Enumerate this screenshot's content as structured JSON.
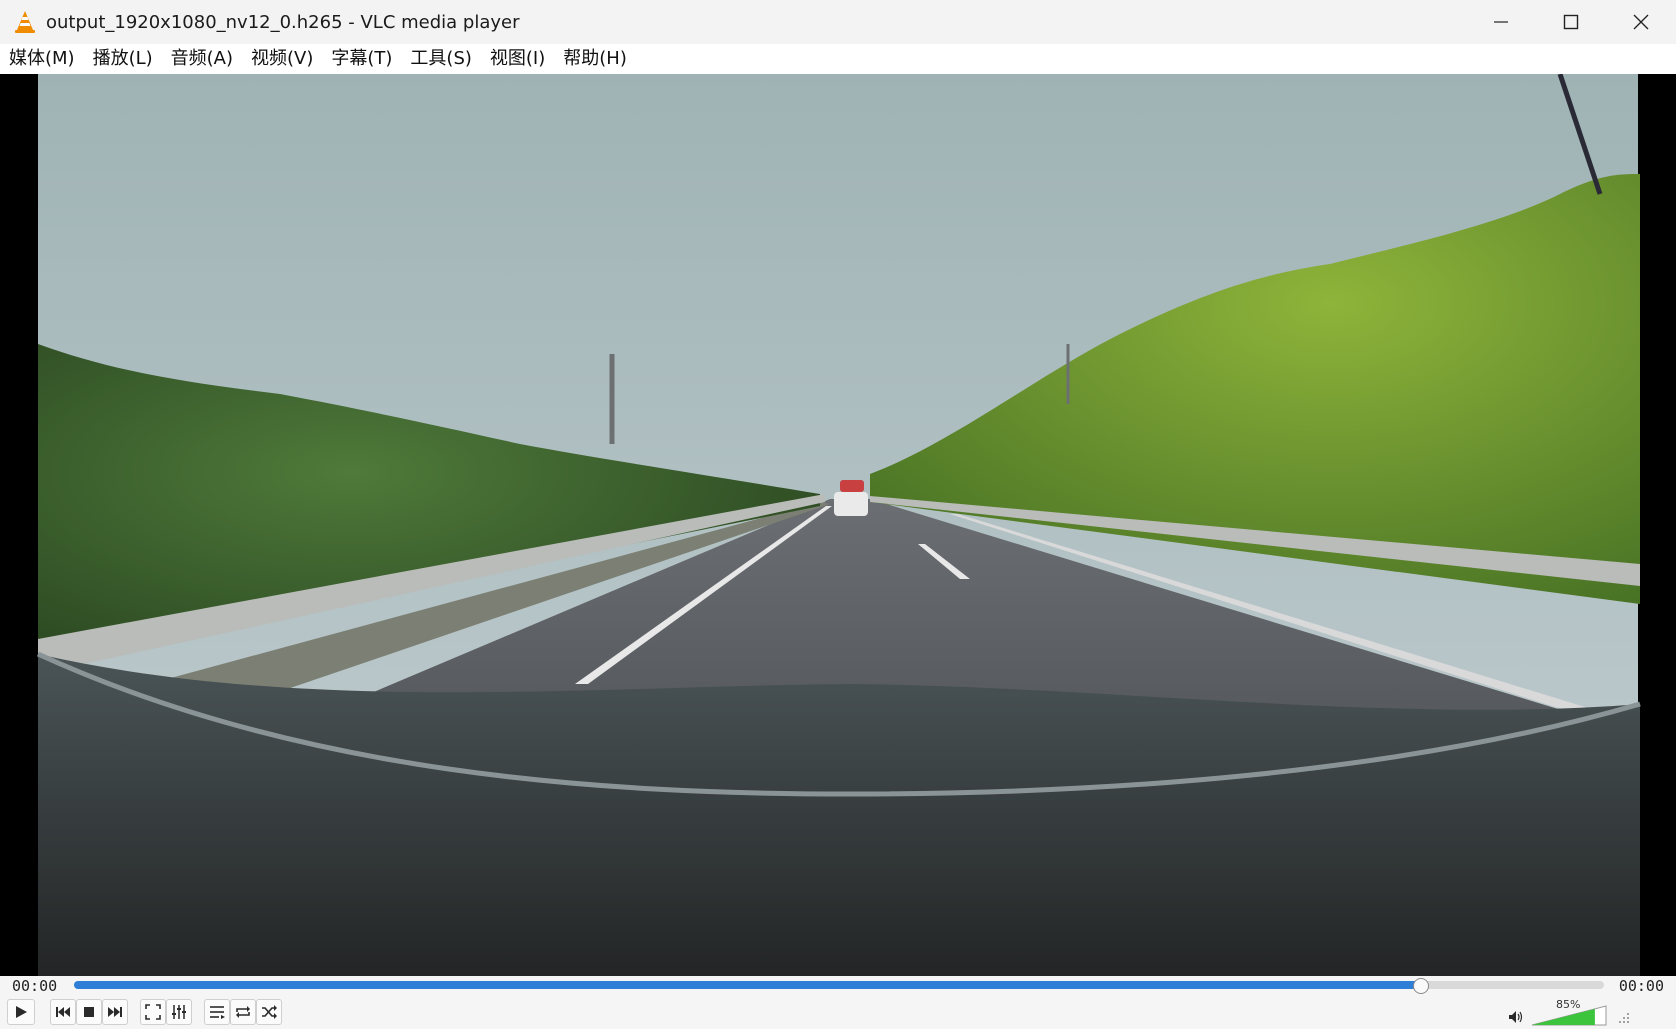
{
  "window": {
    "title": "output_1920x1080_nv12_0.h265 - VLC media player",
    "icon": "vlc-cone-icon"
  },
  "menu": [
    {
      "label": "媒体(M)"
    },
    {
      "label": "播放(L)"
    },
    {
      "label": "音频(A)"
    },
    {
      "label": "视频(V)"
    },
    {
      "label": "字幕(T)"
    },
    {
      "label": "工具(S)"
    },
    {
      "label": "视图(I)"
    },
    {
      "label": "帮助(H)"
    }
  ],
  "player": {
    "time_elapsed": "00:00",
    "time_total": "00:00",
    "seek_position": 0.88,
    "volume_text": "85%",
    "volume_level": 0.85
  },
  "colors": {
    "accent": "#2f7fd8",
    "volume_fill": "#3cc43c"
  }
}
